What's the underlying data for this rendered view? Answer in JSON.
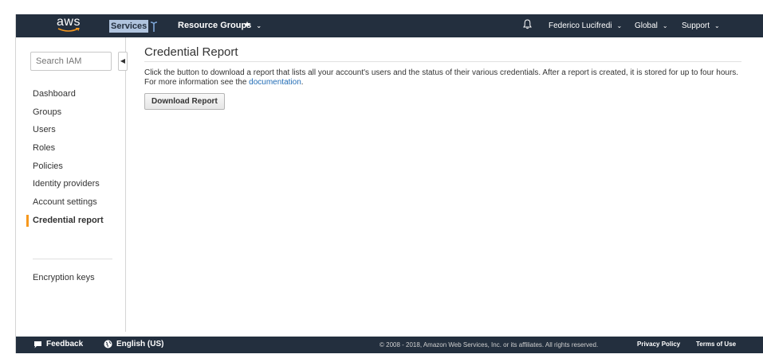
{
  "topnav": {
    "logo_text": "aws",
    "services": "Services",
    "resource_groups": "Resource Groups",
    "user": "Federico Lucifredi",
    "region": "Global",
    "support": "Support"
  },
  "sidebar": {
    "search_placeholder": "Search IAM",
    "items": [
      {
        "label": "Dashboard"
      },
      {
        "label": "Groups"
      },
      {
        "label": "Users"
      },
      {
        "label": "Roles"
      },
      {
        "label": "Policies"
      },
      {
        "label": "Identity providers"
      },
      {
        "label": "Account settings"
      },
      {
        "label": "Credential report"
      }
    ],
    "active": "Credential report",
    "encryption_keys": "Encryption keys"
  },
  "main": {
    "title": "Credential Report",
    "description": "Click the button to download a report that lists all your account's users and the status of their various credentials. After a report is created, it is stored for up to four hours. For more information see the ",
    "link_text": "documentation",
    "description_end": ".",
    "download_button": "Download Report"
  },
  "footer": {
    "feedback": "Feedback",
    "language": "English (US)",
    "copyright": "© 2008 - 2018, Amazon Web Services, Inc. or its affiliates. All rights reserved.",
    "privacy": "Privacy Policy",
    "terms": "Terms of Use"
  },
  "colors": {
    "nav_bg": "#232f3e",
    "accent": "#f7981d",
    "link": "#1f6bb5"
  }
}
